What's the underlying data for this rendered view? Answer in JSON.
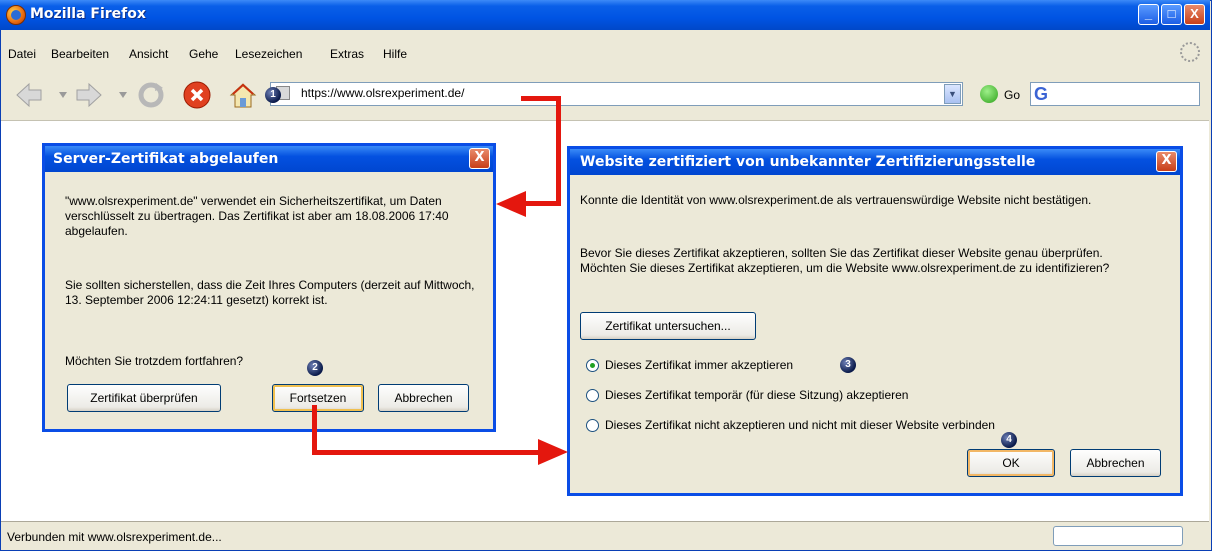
{
  "window": {
    "title": "Mozilla Firefox",
    "minimize": "_",
    "maximize": "□",
    "close": "X"
  },
  "menu": [
    "Datei",
    "Bearbeiten",
    "Ansicht",
    "Gehe",
    "Lesezeichen",
    "Extras",
    "Hilfe"
  ],
  "toolbar": {
    "url": "https://www.olsrexperiment.de/",
    "go_label": "Go",
    "search_engine": "G"
  },
  "status": {
    "text": "Verbunden mit www.olsrexperiment.de..."
  },
  "dialog_expired": {
    "title": "Server-Zertifikat abgelaufen",
    "close": "X",
    "paragraph1": "\"www.olsrexperiment.de\" verwendet ein Sicherheitszertifikat, um Daten verschlüsselt zu übertragen. Das Zertifikat ist aber am 18.08.2006 17:40 abgelaufen.",
    "paragraph2": "Sie sollten sicherstellen, dass die Zeit Ihres Computers (derzeit auf Mittwoch, 13. September 2006 12:24:11 gesetzt) korrekt ist.",
    "question": "Möchten Sie trotzdem fortfahren?",
    "btn_check": "Zertifikat überprüfen",
    "btn_continue": "Fortsetzen",
    "btn_cancel": "Abbrechen"
  },
  "dialog_unknown_ca": {
    "title": "Website zertifiziert von unbekannter Zertifizierungsstelle",
    "close": "X",
    "paragraph1": "Konnte die Identität von www.olsrexperiment.de als vertrauenswürdige Website nicht bestätigen.",
    "paragraph2": "Bevor Sie dieses Zertifikat akzeptieren, sollten Sie das Zertifikat dieser Website genau überprüfen. Möchten Sie dieses Zertifikat akzeptieren, um die Website www.olsrexperiment.de zu identifizieren?",
    "btn_examine": "Zertifikat untersuchen...",
    "options": [
      "Dieses Zertifikat immer akzeptieren",
      "Dieses Zertifikat temporär (für diese Sitzung) akzeptieren",
      "Dieses Zertifikat nicht akzeptieren und nicht mit dieser Website verbinden"
    ],
    "selected_option": 0,
    "btn_ok": "OK",
    "btn_cancel": "Abbrechen"
  },
  "steps": [
    "1",
    "2",
    "3",
    "4"
  ],
  "colors": {
    "annotation_arrow": "#e4170e",
    "title_bar": "#0054e3"
  }
}
